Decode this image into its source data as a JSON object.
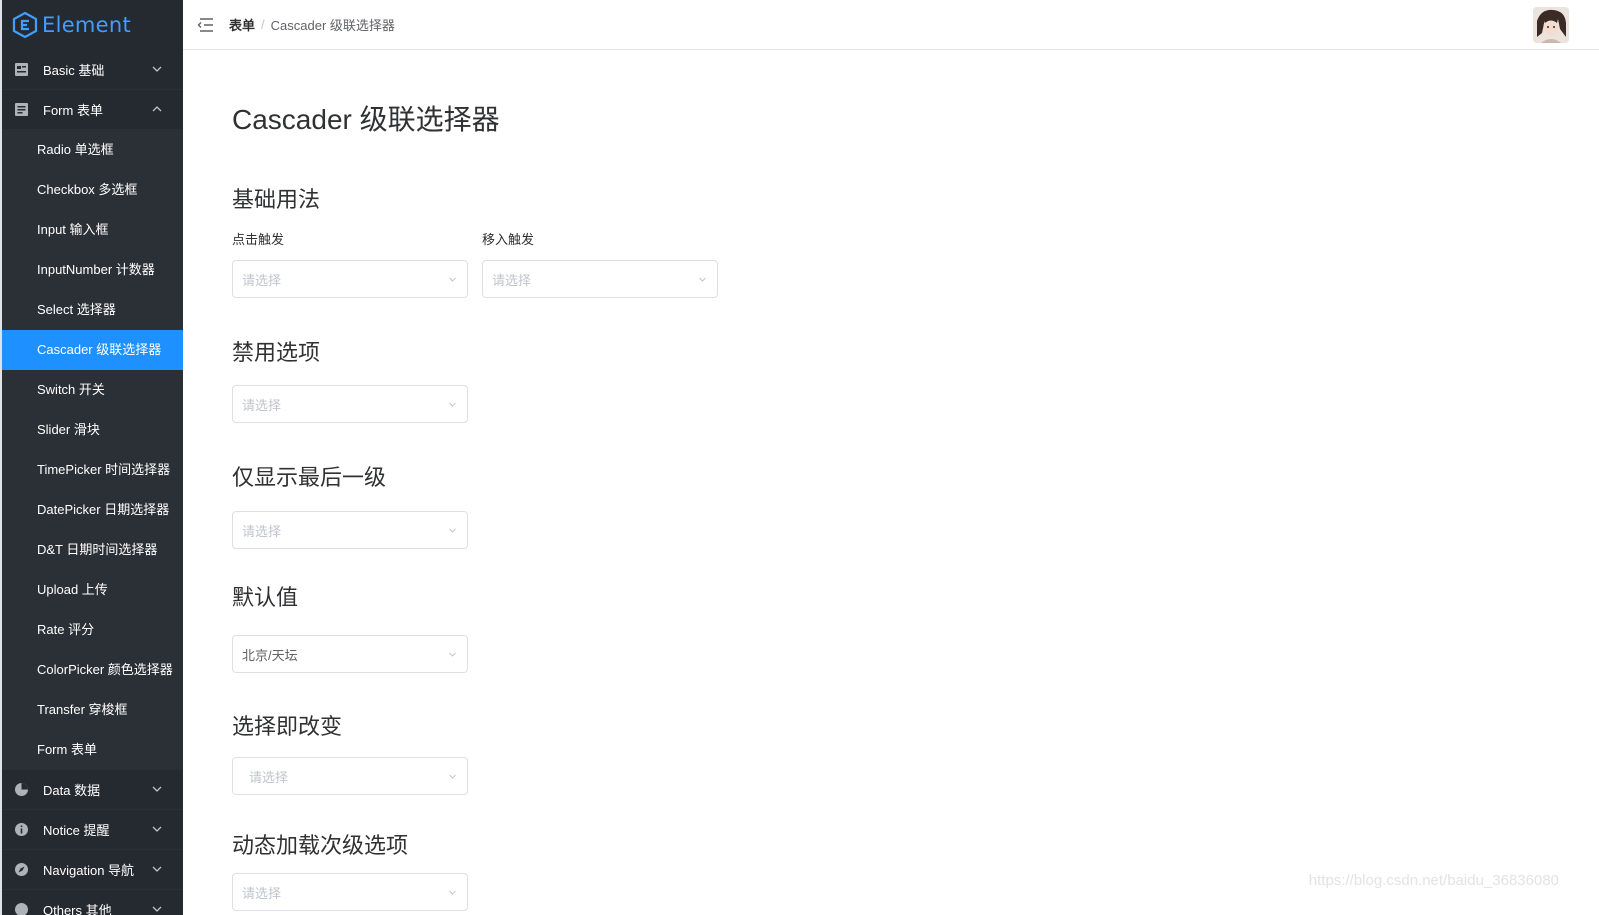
{
  "logo": {
    "text": "Element"
  },
  "sidebar": {
    "groups_top": [
      {
        "label": "Basic 基础",
        "icon": "grid-icon",
        "expanded": false
      },
      {
        "label": "Form 表单",
        "icon": "form-icon",
        "expanded": true
      }
    ],
    "form_items": [
      {
        "label": "Radio 单选框"
      },
      {
        "label": "Checkbox 多选框"
      },
      {
        "label": "Input 输入框"
      },
      {
        "label": "InputNumber 计数器"
      },
      {
        "label": "Select 选择器"
      },
      {
        "label": "Cascader 级联选择器",
        "active": true
      },
      {
        "label": "Switch 开关"
      },
      {
        "label": "Slider 滑块"
      },
      {
        "label": "TimePicker 时间选择器"
      },
      {
        "label": "DatePicker 日期选择器"
      },
      {
        "label": "D&T 日期时间选择器"
      },
      {
        "label": "Upload 上传"
      },
      {
        "label": "Rate 评分"
      },
      {
        "label": "ColorPicker 颜色选择器"
      },
      {
        "label": "Transfer 穿梭框"
      },
      {
        "label": "Form 表单"
      }
    ],
    "groups_bottom": [
      {
        "label": "Data 数据",
        "icon": "pie-icon"
      },
      {
        "label": "Notice 提醒",
        "icon": "info-icon"
      },
      {
        "label": "Navigation 导航",
        "icon": "compass-icon"
      },
      {
        "label": "Others 其他",
        "icon": "more-icon"
      }
    ],
    "active_color": "#1e90ff"
  },
  "header": {
    "breadcrumb_root": "表单",
    "breadcrumb_sep": "/",
    "breadcrumb_current": "Cascader 级联选择器"
  },
  "main": {
    "title": "Cascader 级联选择器",
    "sections": {
      "basic": {
        "title": "基础用法",
        "click_label": "点击触发",
        "hover_label": "移入触发",
        "click_placeholder": "请选择",
        "hover_placeholder": "请选择"
      },
      "disabled": {
        "title": "禁用选项",
        "placeholder": "请选择"
      },
      "last_level": {
        "title": "仅显示最后一级",
        "placeholder": "请选择"
      },
      "default": {
        "title": "默认值",
        "value": "北京/天坛"
      },
      "change_on_select": {
        "title": "选择即改变",
        "placeholder": "请选择"
      },
      "dynamic": {
        "title": "动态加载次级选项",
        "placeholder": "请选择"
      }
    }
  },
  "watermark": "https://blog.csdn.net/baidu_36836080"
}
